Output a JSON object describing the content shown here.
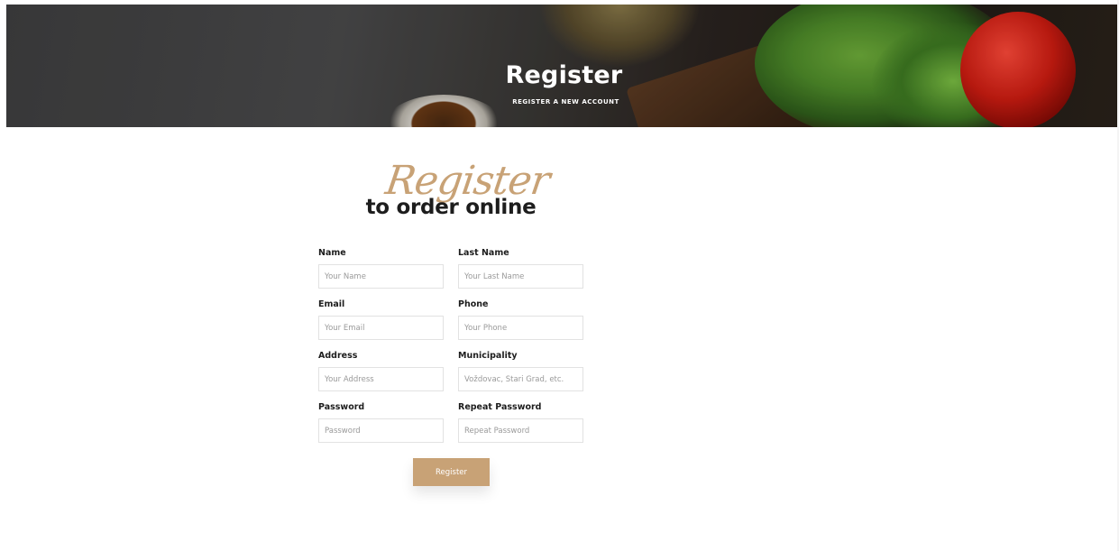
{
  "hero": {
    "title": "Register",
    "subtitle": "REGISTER A NEW ACCOUNT"
  },
  "intro": {
    "script_word": "Register",
    "heading": "to order online"
  },
  "form": {
    "name": {
      "label": "Name",
      "placeholder": "Your Name"
    },
    "last_name": {
      "label": "Last Name",
      "placeholder": "Your Last Name"
    },
    "email": {
      "label": "Email",
      "placeholder": "Your Email"
    },
    "phone": {
      "label": "Phone",
      "placeholder": "Your Phone"
    },
    "address": {
      "label": "Address",
      "placeholder": "Your Address"
    },
    "municipality": {
      "label": "Municipality",
      "placeholder": "Voždovac, Stari Grad, etc."
    },
    "password": {
      "label": "Password",
      "placeholder": "Password"
    },
    "repeat_password": {
      "label": "Repeat Password",
      "placeholder": "Repeat Password"
    },
    "submit_label": "Register"
  },
  "colors": {
    "accent": "#c8a276",
    "heading": "#1d1d1d"
  }
}
